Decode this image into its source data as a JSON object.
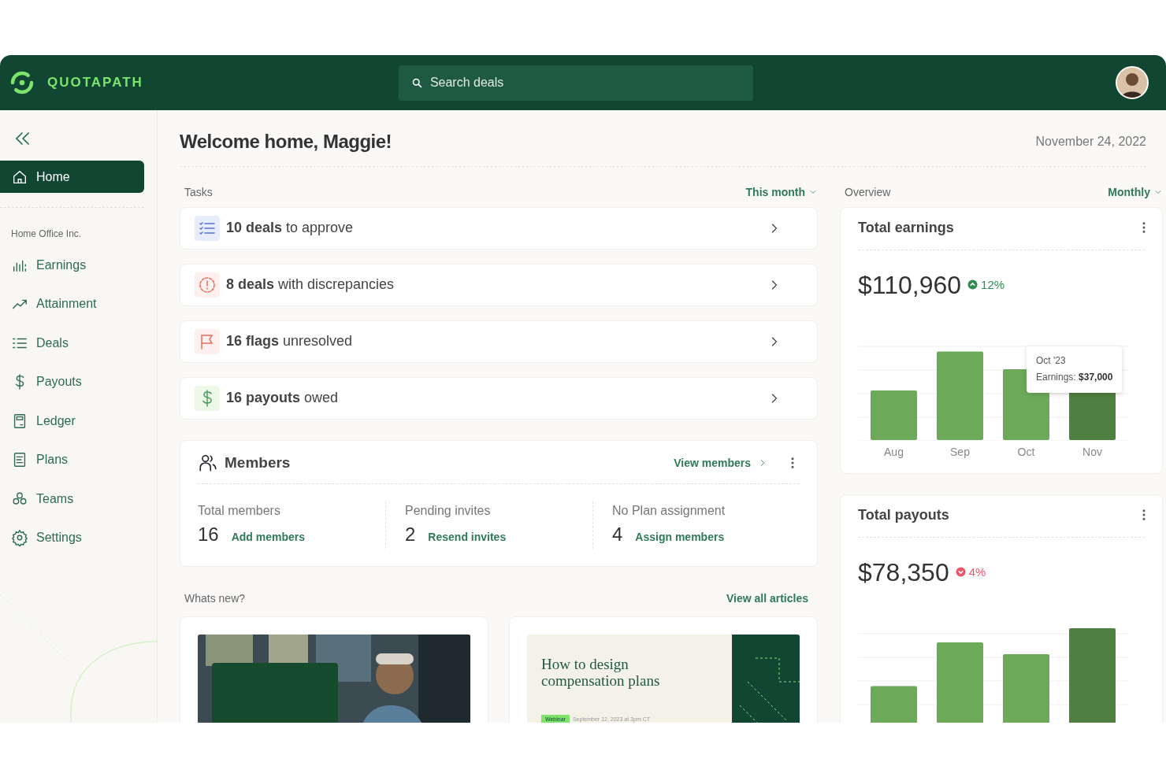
{
  "header": {
    "brand": "QUOTAPATH",
    "search": {
      "placeholder": "Search deals"
    }
  },
  "sidebar": {
    "org": "Home Office Inc.",
    "items": [
      {
        "label": "Home",
        "selected": true
      },
      {
        "label": "Earnings",
        "selected": false
      },
      {
        "label": "Attainment",
        "selected": false
      },
      {
        "label": "Deals",
        "selected": false
      },
      {
        "label": "Payouts",
        "selected": false
      },
      {
        "label": "Ledger",
        "selected": false
      },
      {
        "label": "Plans",
        "selected": false
      },
      {
        "label": "Teams",
        "selected": false
      },
      {
        "label": "Settings",
        "selected": false
      }
    ]
  },
  "page": {
    "title": "Welcome home, Maggie!",
    "date": "November 24, 2022"
  },
  "tasks": {
    "label": "Tasks",
    "filter": "This month",
    "items": [
      {
        "kind": "list",
        "text": "**10 deals** to approve"
      },
      {
        "kind": "alert",
        "text": "**8 deals** with discrepancies"
      },
      {
        "kind": "flag",
        "text": "**16 flags** unresolved"
      },
      {
        "kind": "dollar",
        "text": "**16 payouts** owed"
      }
    ]
  },
  "members": {
    "title": "Members",
    "link": "View members",
    "stats": [
      {
        "label": "Total members",
        "value": "16",
        "action": "Add members"
      },
      {
        "label": "Pending invites",
        "value": "2",
        "action": "Resend invites"
      },
      {
        "label": "No Plan assignment",
        "value": "4",
        "action": "Assign members"
      }
    ]
  },
  "whats_new": {
    "label": "Whats new?",
    "link": "View all articles",
    "articles": [
      {
        "kind": "picture"
      },
      {
        "kind": "graphic",
        "title": "How to design compensation plans",
        "tag": "Webinar",
        "date": "September 12, 2023 at 3pm CT"
      }
    ]
  },
  "overview": {
    "label": "Overview",
    "filter": "Monthly",
    "cards": [
      {
        "title": "Total earnings",
        "amount": "$110,960",
        "rising": true,
        "change": "12%",
        "months": [
          "Aug",
          "Sep",
          "Oct",
          "Nov"
        ],
        "tooltip": {
          "title": "Oct '23",
          "text": "Earnings: **$37,000**"
        }
      },
      {
        "title": "Total payouts",
        "amount": "$78,350",
        "rising": false,
        "change": "4%"
      }
    ]
  }
}
